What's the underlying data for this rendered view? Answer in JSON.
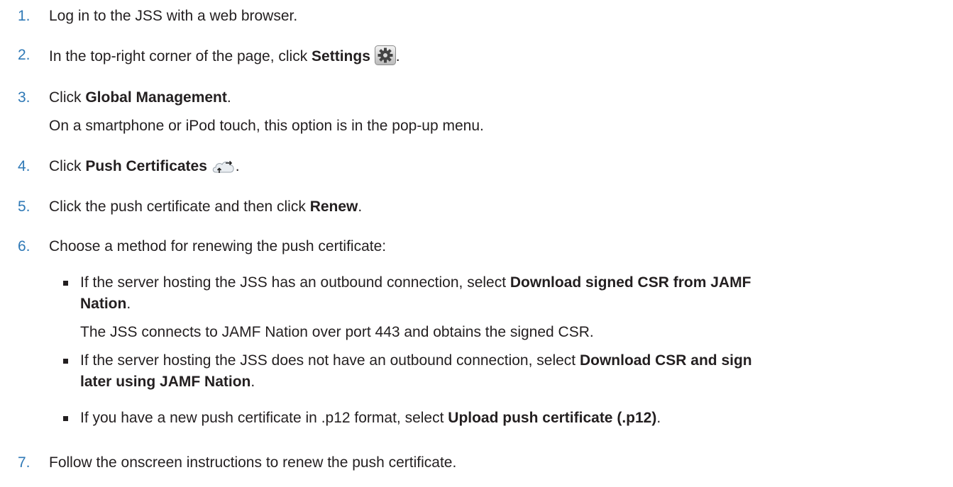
{
  "steps": [
    {
      "num": "1.",
      "text": "Log in to the JSS with a web browser."
    },
    {
      "num": "2.",
      "pre": "In the top-right corner of the page, click ",
      "bold": "Settings",
      "post": "."
    },
    {
      "num": "3.",
      "pre": "Click ",
      "bold": "Global Management",
      "post": ".",
      "note": "On a smartphone or iPod touch, this option is in the pop-up menu."
    },
    {
      "num": "4.",
      "pre": "Click ",
      "bold": "Push Certificates",
      "post": "."
    },
    {
      "num": "5.",
      "pre": "Click the push certificate and then click ",
      "bold": "Renew",
      "post": "."
    },
    {
      "num": "6.",
      "text": "Choose a method for renewing the push certificate:"
    },
    {
      "num": "7.",
      "text": "Follow the onscreen instructions to renew the push certificate."
    }
  ],
  "options": [
    {
      "pre": "If the server hosting the JSS has an outbound connection, select ",
      "bold1": "Download signed CSR from JAMF",
      "bold2": "Nation",
      "post": ".",
      "note": "The JSS connects to JAMF Nation over port 443 and obtains the signed CSR."
    },
    {
      "pre": "If the server hosting the JSS does not have an outbound connection, select ",
      "bold1": "Download CSR and sign",
      "bold2": "later using JAMF Nation",
      "post": "."
    },
    {
      "pre": "If you have a new push certificate in .p12 format, select ",
      "bold": "Upload push certificate (.p12)",
      "post": "."
    }
  ],
  "icons": {
    "settings": "gear-icon",
    "push_certificates": "cloud-arrows-icon"
  }
}
